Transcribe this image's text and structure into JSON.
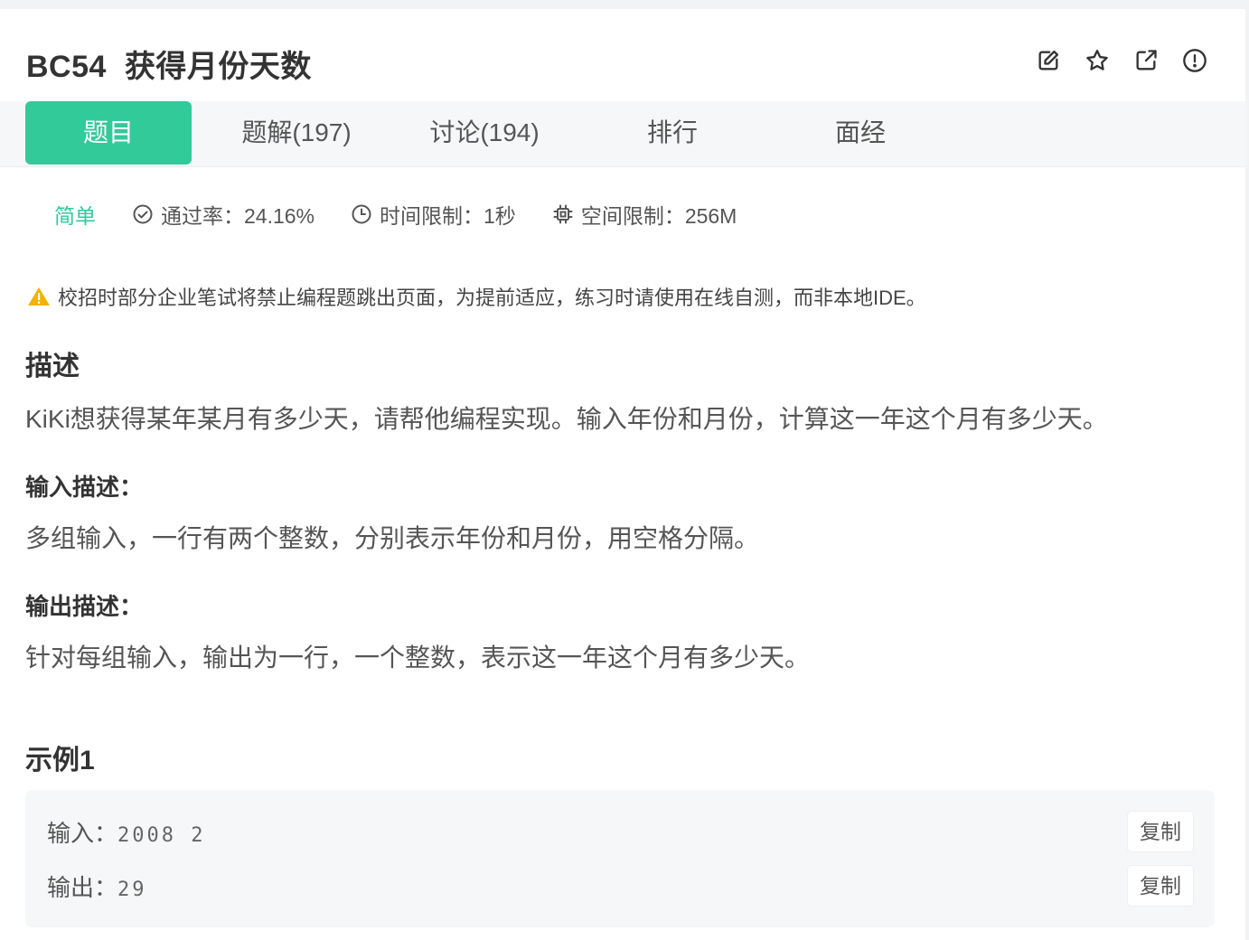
{
  "problem": {
    "id": "BC54",
    "title": "获得月份天数"
  },
  "actions": [
    {
      "icon": "edit-icon"
    },
    {
      "icon": "star-icon"
    },
    {
      "icon": "share-icon"
    },
    {
      "icon": "report-icon"
    }
  ],
  "tabs": [
    {
      "label": "题目",
      "active": true
    },
    {
      "label": "题解(197)",
      "active": false
    },
    {
      "label": "讨论(194)",
      "active": false
    },
    {
      "label": "排行",
      "active": false
    },
    {
      "label": "面经",
      "active": false
    }
  ],
  "meta": {
    "difficulty": "简单",
    "pass_rate": "通过率：24.16%",
    "time_limit": "时间限制：1秒",
    "space_limit": "空间限制：256M"
  },
  "notice": "校招时部分企业笔试将禁止编程题跳出页面，为提前适应，练习时请使用在线自测，而非本地IDE。",
  "description": {
    "heading": "描述",
    "text": "KiKi想获得某年某月有多少天，请帮他编程实现。输入年份和月份，计算这一年这个月有多少天。"
  },
  "input_desc": {
    "heading": "输入描述：",
    "text": "多组输入，一行有两个整数，分别表示年份和月份，用空格分隔。"
  },
  "output_desc": {
    "heading": "输出描述：",
    "text": "针对每组输入，输出为一行，一个整数，表示这一年这个月有多少天。"
  },
  "example": {
    "heading": "示例1",
    "input_label": "输入：",
    "input_value": "2008 2",
    "output_label": "输出：",
    "output_value": "29",
    "copy_label": "复制"
  },
  "colors": {
    "accent": "#32ca99",
    "warning": "#f0b400"
  }
}
